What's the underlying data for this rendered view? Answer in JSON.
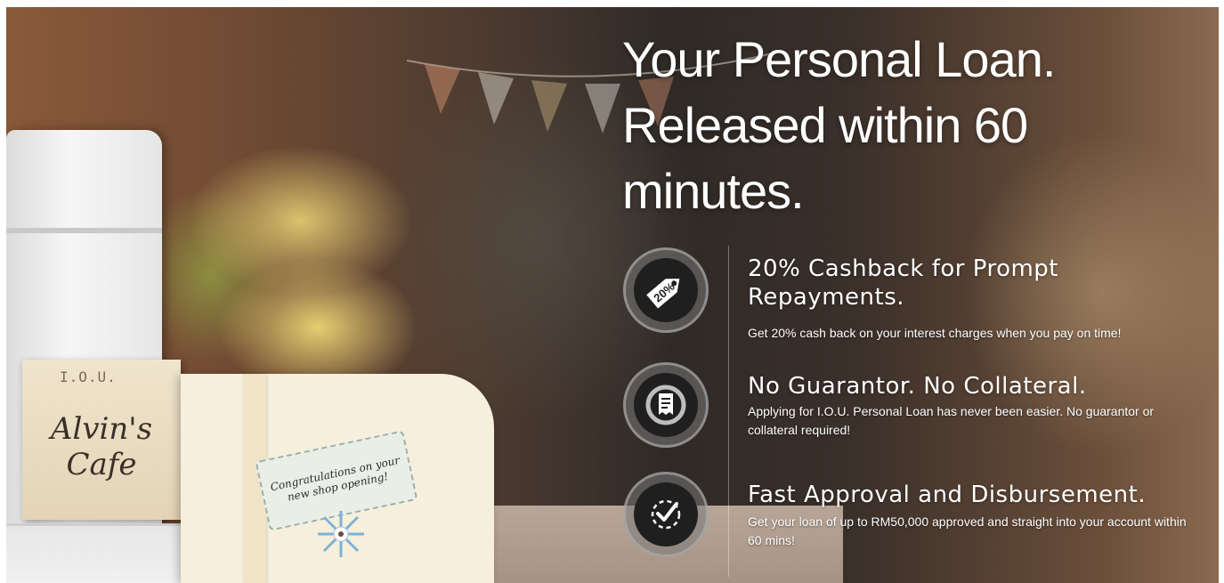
{
  "hero": {
    "headline": "Your Personal Loan. Released within 60 minutes.",
    "photo": {
      "iou_label": "I.O.U.",
      "cafe_name": "Alvin's Cafe",
      "card_message": "Congratulations on your new shop opening!"
    },
    "features": [
      {
        "icon": "price-tag-icon",
        "icon_text": "20%",
        "title": "20% Cashback for Prompt Repayments.",
        "description": "Get 20% cash back on your interest charges when you pay on time!"
      },
      {
        "icon": "document-shield-icon",
        "title": "No Guarantor. No Collateral.",
        "description": "Applying for I.O.U. Personal Loan has never been easier. No guarantor or collateral required!"
      },
      {
        "icon": "check-badge-icon",
        "title": "Fast Approval and Disbursement.",
        "description": "Get your loan of up to RM50,000 approved and straight into your account within 60 mins!"
      }
    ]
  },
  "colors": {
    "text": "#ffffff",
    "icon_ring": "#8a8a8a",
    "icon_fill": "#1f1f1f"
  }
}
